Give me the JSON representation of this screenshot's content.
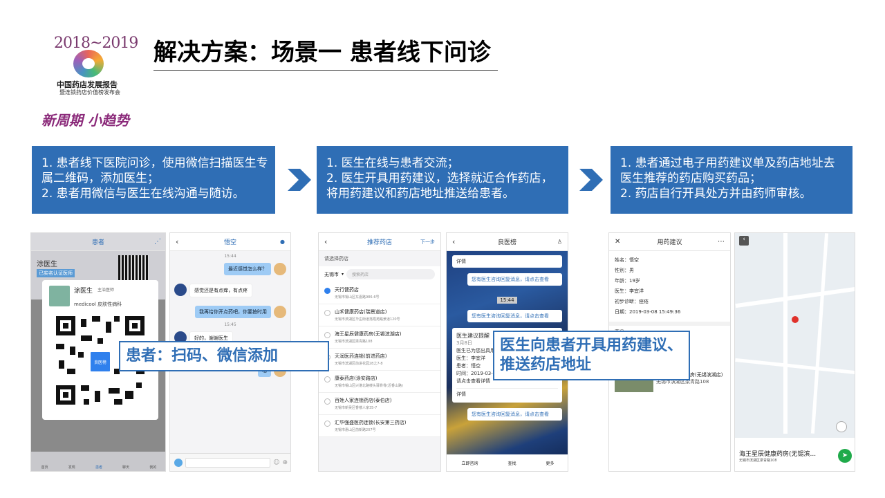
{
  "logo": {
    "years": "2018~2019",
    "name": "中国药店发展报告",
    "subtitle": "暨连锁药店价值榜发布会",
    "slogan": "新周期 小趋势"
  },
  "title": "解决方案：场景一 患者线下问诊",
  "steps": [
    {
      "text": "1. 患者线下医院问诊，使用微信扫描医生专属二维码，添加医生；\n2. 患者用微信与医生在线沟通与随访。"
    },
    {
      "text": "1. 医生在线与患者交流；\n2. 医生开具用药建议，选择就近合作药店，将用药建议和药店地址推送给患者。"
    },
    {
      "text": "1. 患者通过电子用药建议单及药店地址去医生推荐的药店购买药品；\n2. 药店自行开具处方并由药师审核。"
    }
  ],
  "callouts": {
    "scan": "患者：扫码、微信添加",
    "prescribe": "医生向患者开具用药建议、推送药店地址"
  },
  "screen1": {
    "header": "患者",
    "doctor": "涂医生",
    "badge": "主治医师",
    "verified": "已实名认证医师",
    "hospital": "medicool 皮肤性病科",
    "qr_label": "良医榜",
    "tabs": [
      "首页",
      "发现",
      "患者",
      "聊天",
      "我的"
    ]
  },
  "screen2": {
    "header": "悟空",
    "time1": "15:44",
    "msg1": "最近感觉怎么样？",
    "msg2": "感觉还是有点痒，有点疼",
    "msg3": "我再给你开点药吧，你要按时用",
    "time2": "15:45",
    "msg4": "好的，谢谢医生",
    "msg5": "嗯"
  },
  "screen3": {
    "header": "推荐药店",
    "next": "下一步",
    "prompt": "请选择药店",
    "city": "无锡市",
    "search_placeholder": "搜索药店",
    "stores": [
      {
        "name": "天行健药店",
        "addr": "无锡市锡山区东嘉路986-6号",
        "selected": true
      },
      {
        "name": "山禾健康药店(瑞景道店)",
        "addr": "无锡市滨湖区华庄街道落霞苑路景道120号",
        "selected": false
      },
      {
        "name": "海王星辰健康药房(无锡滨湖店)",
        "addr": "无锡市滨湖区梁青路108",
        "selected": false
      },
      {
        "name": "天润医药连锁(前进药店)",
        "addr": "无锡市滨湖区前进花园28之7-8",
        "selected": false
      },
      {
        "name": "康泰药店(涂安路店)",
        "addr": "无锡市锡山区兴港北路楼头驿骨骨(近香山路)",
        "selected": false
      },
      {
        "name": "百姓人家连锁药店(泰伯店)",
        "addr": "无锡市新吴区香楼人家35-7",
        "selected": false
      },
      {
        "name": "汇华强盛医药连锁(长安第三药店)",
        "addr": "无锡市惠山区前新路207号",
        "selected": false
      }
    ]
  },
  "screen4": {
    "header": "良医榜",
    "detail": "详情",
    "reply_notice": "您有医生咨询回复消息，请点击查看",
    "time": "15:44",
    "card_title": "医生建议提醒",
    "card_date": "3月8日",
    "card_line1": "医生已为您出具用药建议",
    "card_doctor": "医生：李宜洋",
    "card_patient": "患者：悟空",
    "card_time": "时间：2019-03-08 15:48",
    "card_cta": "请点击查看详情",
    "footer": [
      "立即咨询",
      "查找",
      "更多"
    ]
  },
  "screen5": {
    "header": "用药建议",
    "name": "姓名：悟空",
    "gender": "性别：男",
    "age": "年龄：19岁",
    "doctor": "医生：李宜洋",
    "diagnosis": "初步诊断：痤疮",
    "date": "日期：2019-03-08 15:49:36",
    "drug_label": "药品",
    "store_name": "海王星辰健康药房(无锡滨湖店)",
    "store_addr": "无锡市滨湖区梁青路108"
  },
  "screen6": {
    "store_name": "海王星辰健康药房(无锡滨...",
    "store_addr": "无锡市滨湖区梁青路108"
  }
}
